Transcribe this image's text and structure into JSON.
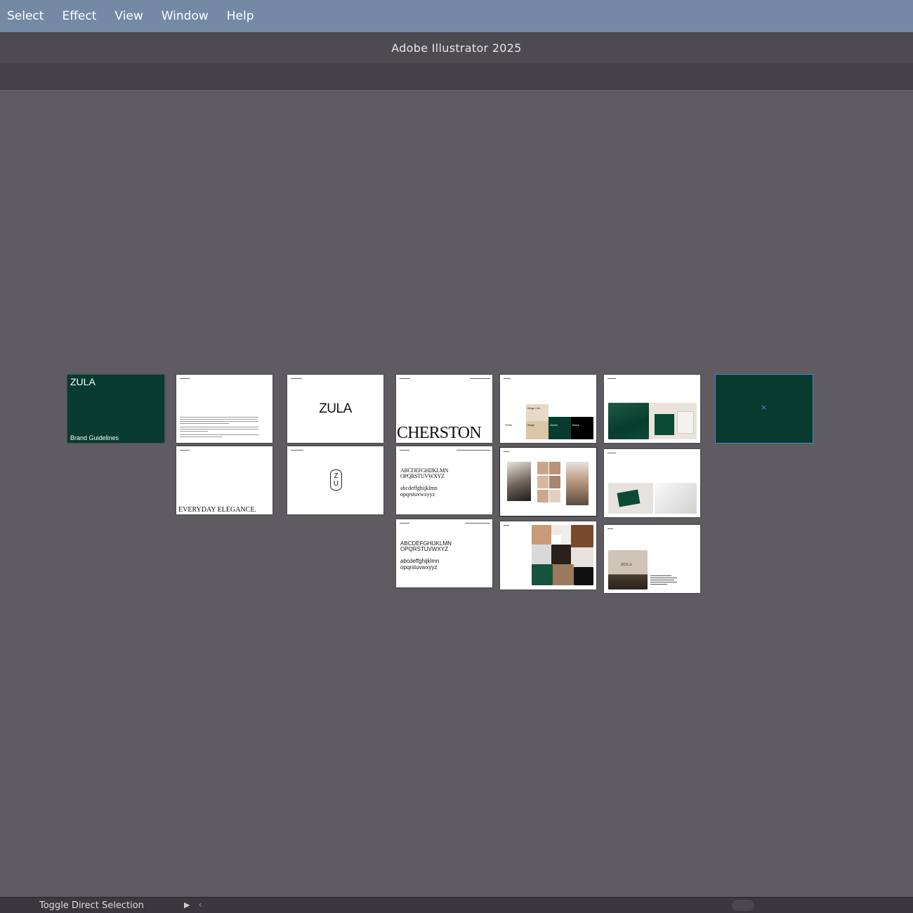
{
  "menu": {
    "items": [
      {
        "label": "Select"
      },
      {
        "label": "Effect"
      },
      {
        "label": "View"
      },
      {
        "label": "Window"
      },
      {
        "label": "Help"
      }
    ]
  },
  "window": {
    "title": "Adobe Illustrator 2025"
  },
  "artboards": {
    "cover": {
      "logo": "ZULA",
      "subtitle": "Brand Guidelines"
    },
    "logo_page": {
      "logo": "ZULA",
      "monogram_top": "Z",
      "monogram_bottom": "U"
    },
    "tagline_page": {
      "tagline": "EVERYDAY ELEGANCE."
    },
    "typography_primary": {
      "font_name": "CHERSTON"
    },
    "typography_specimen_1": {
      "upper_1": "ABCDEFGHIJKLMN",
      "upper_2": "OPQRSTUVWXYZ",
      "lower_1": "abcdeffghijklmn",
      "lower_2": "opqrstuvwxyyz"
    },
    "typography_specimen_2": {
      "upper_1": "ABCDEFGHIJKLMN",
      "upper_2": "OPQRSTUVWXYZ",
      "lower_1": "abcdeffghijklmn",
      "lower_2": "opqrstuvwxyyz"
    },
    "colours": {
      "swatches": [
        {
          "name": "Beige Lite",
          "color": "#e6d9c6"
        },
        {
          "name": "Beige",
          "color": "#dcc6a8"
        },
        {
          "name": "Green",
          "color": "#073c2e"
        },
        {
          "name": "Black",
          "color": "#000000"
        },
        {
          "name": "White",
          "color": "#ffffff"
        }
      ]
    },
    "signage_page": {
      "sign_text": "ZULA"
    },
    "selected_marker": "×"
  },
  "status_bar": {
    "tool_label": "Toggle Direct Selection"
  },
  "colors": {
    "brand_green": "#073c2e",
    "selection_blue": "#5b7fe0",
    "menubar": "#7389a4"
  }
}
